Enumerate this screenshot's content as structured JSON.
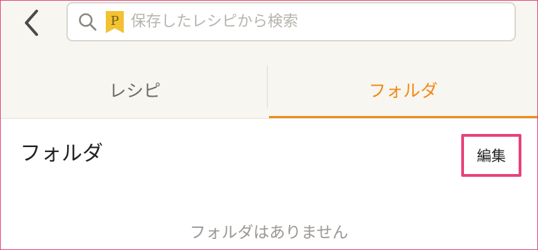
{
  "header": {
    "back_icon": "chevron-left-icon",
    "search": {
      "placeholder": "保存したレシピから検索",
      "value": "",
      "search_icon": "magnifier-icon",
      "badge_letter": "P"
    }
  },
  "tabs": [
    {
      "label": "レシピ",
      "active": false
    },
    {
      "label": "フォルダ",
      "active": true
    }
  ],
  "folders": {
    "title": "フォルダ",
    "edit_label": "編集",
    "empty_message": "フォルダはありません"
  },
  "colors": {
    "accent_orange": "#f08a16",
    "highlight_pink": "#e8417b",
    "header_background": "#f8f6f1",
    "badge_yellow": "#f2c230"
  }
}
